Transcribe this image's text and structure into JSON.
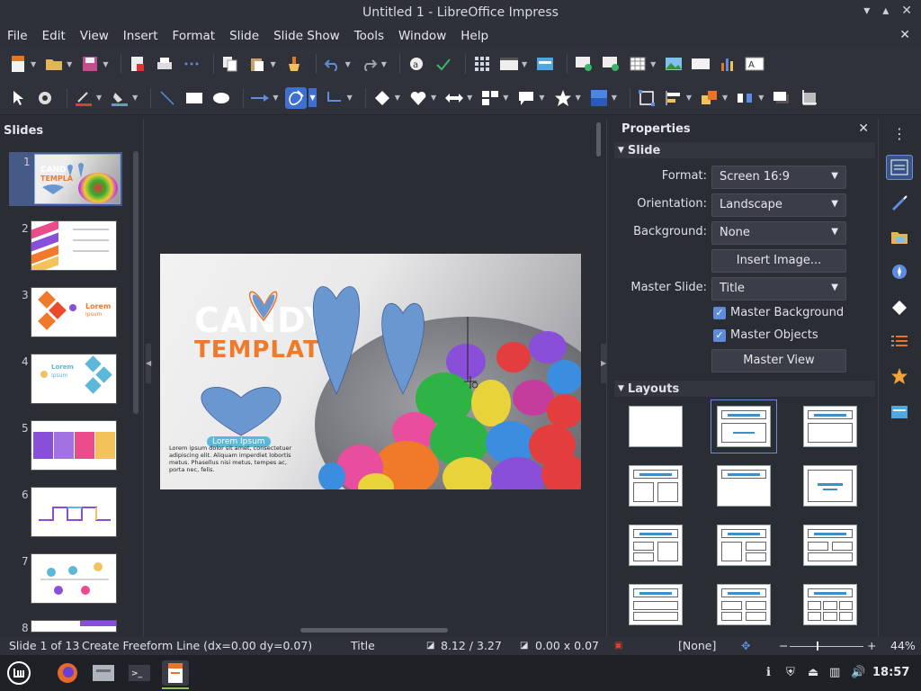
{
  "window": {
    "title": "Untitled 1 - LibreOffice Impress"
  },
  "menu": [
    "File",
    "Edit",
    "View",
    "Insert",
    "Format",
    "Slide",
    "Slide Show",
    "Tools",
    "Window",
    "Help"
  ],
  "slides_panel": {
    "header": "Slides",
    "numbers": [
      "1",
      "2",
      "3",
      "4",
      "5",
      "6",
      "7",
      "8"
    ]
  },
  "slide": {
    "title_line1": "CANDY",
    "title_line2": "TEMPLATE",
    "label": "Lorem Ipsum",
    "body": "Lorem ipsum dolor sit amet, consectetuer adipiscing elit. Aliquam imperdiet lobortis metus. Phasellus nisi metus, tempes ac, porta nec, felis.",
    "thumb3_title": "Lorem",
    "thumb3_sub": "Ipsum",
    "thumb4_title": "Lorem",
    "thumb4_sub": "Ipsum"
  },
  "properties": {
    "header": "Properties",
    "slide_section": "Slide",
    "format_label": "Format:",
    "format_value": "Screen 16:9",
    "orientation_label": "Orientation:",
    "orientation_value": "Landscape",
    "background_label": "Background:",
    "background_value": "None",
    "insert_image": "Insert Image...",
    "master_slide_label": "Master Slide:",
    "master_slide_value": "Title",
    "master_background": "Master Background",
    "master_objects": "Master Objects",
    "master_view": "Master View",
    "layouts_section": "Layouts"
  },
  "status": {
    "slide_of": "Slide 1 of 13",
    "action": "Create Freeform Line (dx=0.00 dy=0.07)",
    "layout": "Title",
    "position": "8.12 / 3.27",
    "size": "0.00 x 0.07",
    "language": "[None]",
    "zoom": "44%"
  },
  "taskbar": {
    "clock": "18:57"
  },
  "colors": {
    "accent": "#3f6fd1",
    "heart": "#6b97d1",
    "orange": "#f07a2a"
  }
}
